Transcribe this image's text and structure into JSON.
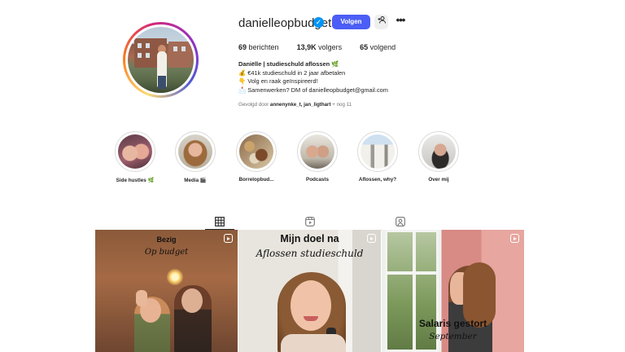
{
  "profile": {
    "username": "danielleopbudget",
    "verified_mark": "✓",
    "follow_label": "Volgen",
    "suggest_label": "+👤",
    "more_label": "•••",
    "stats": {
      "posts_count": "69",
      "posts_label": "berichten",
      "followers_count": "13,9K",
      "followers_label": "volgers",
      "following_count": "65",
      "following_label": "volgend"
    },
    "bio": {
      "name": "Daniëlle | studieschuld aflossen 🌿",
      "line1": "💰 €41k studieschuld in 2 jaar afbetalen",
      "line2": "👇 Volg en raak geïnspireerd!",
      "line3": "📩 Samenwerken? DM of danielleopbudget@gmail.com"
    },
    "followed_by": {
      "prefix": "Gevolgd door",
      "names": "annenynke_t, jan_ligthart",
      "suffix": "+ nog 11"
    }
  },
  "highlights": [
    {
      "label": "Side hustles 🌿",
      "icon": "highlight-side-hustles"
    },
    {
      "label": "Media 🎬",
      "icon": "highlight-media"
    },
    {
      "label": "Borrelopbud...",
      "icon": "highlight-borrel"
    },
    {
      "label": "Podcasts",
      "icon": "highlight-podcasts"
    },
    {
      "label": "Aflossen, why?",
      "icon": "highlight-aflossen"
    },
    {
      "label": "Over mij",
      "icon": "highlight-over-mij"
    }
  ],
  "tabs": [
    {
      "name": "posts",
      "icon": "grid-icon",
      "active": true
    },
    {
      "name": "reels",
      "icon": "reels-icon",
      "active": false
    },
    {
      "name": "tagged",
      "icon": "tagged-icon",
      "active": false
    }
  ],
  "posts": [
    {
      "title": "Bezig",
      "subtitle": "Op budget"
    },
    {
      "title": "Mijn doel na",
      "subtitle": "Aflossen studieschuld"
    },
    {
      "title": "Salaris gestort",
      "subtitle": "September"
    }
  ],
  "colors": {
    "accent": "#4c5ef5",
    "verified": "#0095f6",
    "text": "#262626",
    "muted": "#737373"
  }
}
